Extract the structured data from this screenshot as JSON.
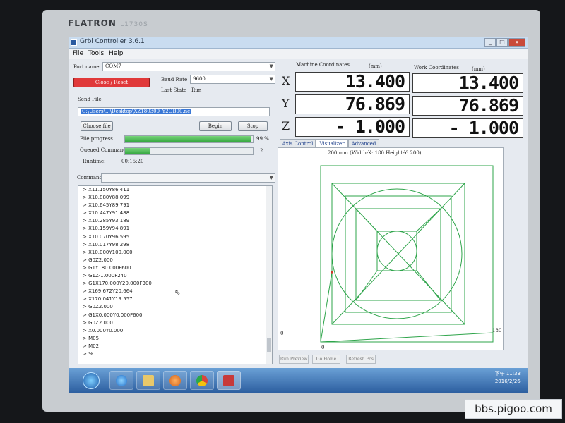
{
  "monitor": {
    "brand": "FLATRON",
    "model": "L1730S"
  },
  "window": {
    "title": "Grbl Controller 3.6.1",
    "btn_min": "_",
    "btn_max": "□",
    "btn_close": "x"
  },
  "menu": {
    "file": "File",
    "tools": "Tools",
    "help": "Help"
  },
  "port": {
    "label": "Port name",
    "value": "COM7"
  },
  "baud": {
    "label": "Baud Rate",
    "value": "9600"
  },
  "close_reset": "Close / Reset",
  "last_state": {
    "label": "Last State",
    "value": "Run"
  },
  "send_file": {
    "label": "Send File",
    "value": "C:\\Users\\...\\Desktop\\XZ180300_Y2OB00.nc"
  },
  "buttons": {
    "choose_file": "Choose file",
    "begin": "Begin",
    "stop": "Stop"
  },
  "file_progress": {
    "label": "File progress",
    "percent_text": "99 %",
    "value": 0.99
  },
  "queued": {
    "label": "Queued Commands",
    "count": "2",
    "value": 0.2
  },
  "runtime": {
    "label": "Runtime:",
    "value": "00:15:20"
  },
  "command": {
    "label": "Command"
  },
  "console_lines": [
    "> X11.150Y86.411",
    "> X10.880Y88.099",
    "> X10.645Y89.791",
    "> X10.447Y91.488",
    "> X10.285Y93.189",
    "> X10.159Y94.891",
    "> X10.070Y96.595",
    "> X10.017Y98.298",
    "> X10.000Y100.000",
    "> G0Z2.000",
    "> G1Y180.000F600",
    "> G1Z-1.000F240",
    "> G1X170.000Y20.000F300",
    "> X169.672Y20.664",
    "> X170.041Y19.557",
    "> G0Z2.000",
    "> G1X0.000Y0.000F600",
    "> G0Z2.000",
    "> X0.000Y0.000",
    "> M05",
    "> M02",
    "> %"
  ],
  "coords": {
    "machine_title": "Machine Coordinates",
    "work_title": "Work Coordinates",
    "unit": "(mm)",
    "axes": [
      "X",
      "Y",
      "Z"
    ],
    "machine": [
      "13.400",
      "76.869",
      "- 1.000"
    ],
    "work": [
      "13.400",
      "76.869",
      "- 1.000"
    ]
  },
  "tabs": [
    "Axis Control",
    "Visualizer",
    "Advanced"
  ],
  "visualizer": {
    "header": "200 mm  (Width-X: 180  Height-Y: 200)",
    "x_min": "0",
    "x_max": "180",
    "y_min": "0",
    "line_color": "#2ea44a"
  },
  "vis_buttons": {
    "preview": "Run Preview",
    "home": "Go Home",
    "refresh": "Refresh Pos"
  },
  "taskbar": {
    "time": "下午 11:33",
    "date": "2016/2/26"
  },
  "watermark": "bbs.pigoo.com"
}
